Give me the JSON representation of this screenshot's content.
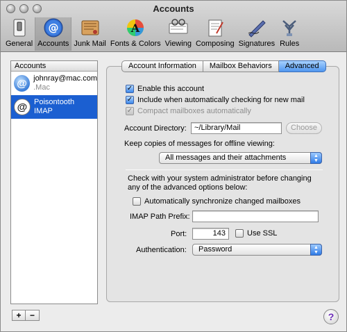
{
  "window": {
    "title": "Accounts"
  },
  "toolbar": {
    "items": [
      {
        "label": "General",
        "icon": "switch-icon"
      },
      {
        "label": "Accounts",
        "icon": "at-sign-icon"
      },
      {
        "label": "Junk Mail",
        "icon": "junk-mail-icon"
      },
      {
        "label": "Fonts & Colors",
        "icon": "fonts-colors-icon"
      },
      {
        "label": "Viewing",
        "icon": "viewing-icon"
      },
      {
        "label": "Composing",
        "icon": "composing-icon"
      },
      {
        "label": "Signatures",
        "icon": "signature-pen-icon"
      },
      {
        "label": "Rules",
        "icon": "rules-icon"
      }
    ],
    "selected": "Accounts"
  },
  "accounts": {
    "header": "Accounts",
    "items": [
      {
        "name": "johnray@mac.com",
        "type": ".Mac",
        "icon": "mac-account-icon"
      },
      {
        "name": "Poisontooth",
        "type": "IMAP",
        "icon": "imap-account-icon"
      }
    ],
    "selected_index": 1
  },
  "tabs": {
    "items": [
      "Account Information",
      "Mailbox Behaviors",
      "Advanced"
    ],
    "selected": "Advanced"
  },
  "advanced": {
    "enable_account": {
      "label": "Enable this account",
      "checked": true
    },
    "include_checking": {
      "label": "Include when automatically checking for new mail",
      "checked": true
    },
    "compact_mailboxes": {
      "label": "Compact mailboxes automatically",
      "checked": true,
      "enabled": false
    },
    "account_directory_label": "Account Directory:",
    "account_directory_value": "~/Library/Mail",
    "choose_button": "Choose",
    "keep_copies_label": "Keep copies of messages for offline viewing:",
    "keep_copies_value": "All messages and their attachments",
    "admin_note": "Check with your system administrator before changing any of the advanced options below:",
    "auto_sync": {
      "label": "Automatically synchronize changed mailboxes",
      "checked": false
    },
    "imap_prefix_label": "IMAP Path Prefix:",
    "imap_prefix_value": "",
    "port_label": "Port:",
    "port_value": "143",
    "use_ssl": {
      "label": "Use SSL",
      "checked": false
    },
    "auth_label": "Authentication:",
    "auth_value": "Password"
  },
  "bottom": {
    "add_label": "+",
    "remove_label": "−",
    "help_label": "?"
  },
  "colors": {
    "selection": "#1b5fd1",
    "aqua_accent": "#4f96ef"
  }
}
